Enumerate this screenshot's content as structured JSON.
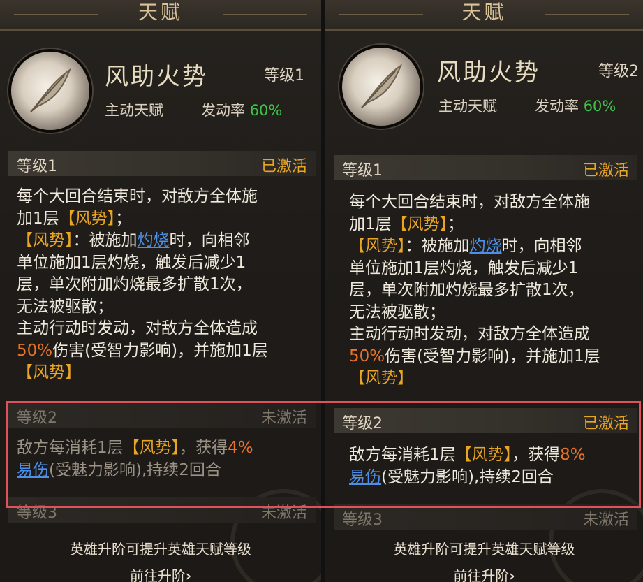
{
  "panels": [
    {
      "title": "天赋",
      "talent": {
        "name": "风助火势",
        "level": "等级1",
        "type": "主动天赋",
        "rate_label": "发动率",
        "rate_value": "60%"
      },
      "level1": {
        "name": "等级1",
        "status": "已激活",
        "lines": [
          [
            "每个大回合结束时，对敌方全体施"
          ],
          [
            "加1层",
            "【风势】",
            "；"
          ],
          [
            "【风势】",
            "：被施加",
            "灼烧",
            "时，向相邻"
          ],
          [
            "单位施加1层灼烧，触发后减少1"
          ],
          [
            "层，单次附加灼烧最多扩散1次，"
          ],
          [
            "无法被驱散；"
          ],
          [
            "主动行动时发动，对敌方全体造成"
          ],
          [
            "50%",
            "伤害(受智力影响)，并施加1层"
          ],
          [
            "【风势】"
          ]
        ]
      },
      "level2": {
        "name": "等级2",
        "status": "未激活",
        "line1_a": "敌方每消耗1层",
        "line1_b": "【风势】",
        "line1_c": "，获得",
        "line1_d": "4%",
        "line2_a": "易伤",
        "line2_b": "(受魅力影响),持续2回合"
      },
      "level3": {
        "name": "等级3",
        "status": "未激活"
      },
      "footer": "英雄升阶可提升英雄天赋等级",
      "goto": "前往升阶",
      "goto_arrow": "›"
    },
    {
      "title": "天赋",
      "talent": {
        "name": "风助火势",
        "level": "等级2",
        "type": "主动天赋",
        "rate_label": "发动率",
        "rate_value": "60%"
      },
      "level1": {
        "name": "等级1",
        "status": "已激活",
        "lines": [
          [
            "每个大回合结束时，对敌方全体施"
          ],
          [
            "加1层",
            "【风势】",
            "；"
          ],
          [
            "【风势】",
            "：被施加",
            "灼烧",
            "时，向相邻"
          ],
          [
            "单位施加1层灼烧，触发后减少1"
          ],
          [
            "层，单次附加灼烧最多扩散1次，"
          ],
          [
            "无法被驱散；"
          ],
          [
            "主动行动时发动，对敌方全体造成"
          ],
          [
            "50%",
            "伤害(受智力影响)，并施加1层"
          ],
          [
            "【风势】"
          ]
        ]
      },
      "level2": {
        "name": "等级2",
        "status": "已激活",
        "line1_a": "敌方每消耗1层",
        "line1_b": "【风势】",
        "line1_c": "，获得",
        "line1_d": "8%",
        "line2_a": "易伤",
        "line2_b": "(受魅力影响),持续2回合"
      },
      "level3": {
        "name": "等级3",
        "status": "未激活"
      },
      "footer": "英雄升阶可提升英雄天赋等级",
      "goto": "前往升阶",
      "goto_arrow": "›"
    }
  ],
  "colors": {
    "activated": "#e9a524",
    "inactive": "#7e766a",
    "rate_green": "#3dc24a",
    "highlight_red": "#e0525b",
    "link_blue": "#4d8fe6"
  },
  "icons": {
    "talent": "feather-icon"
  }
}
